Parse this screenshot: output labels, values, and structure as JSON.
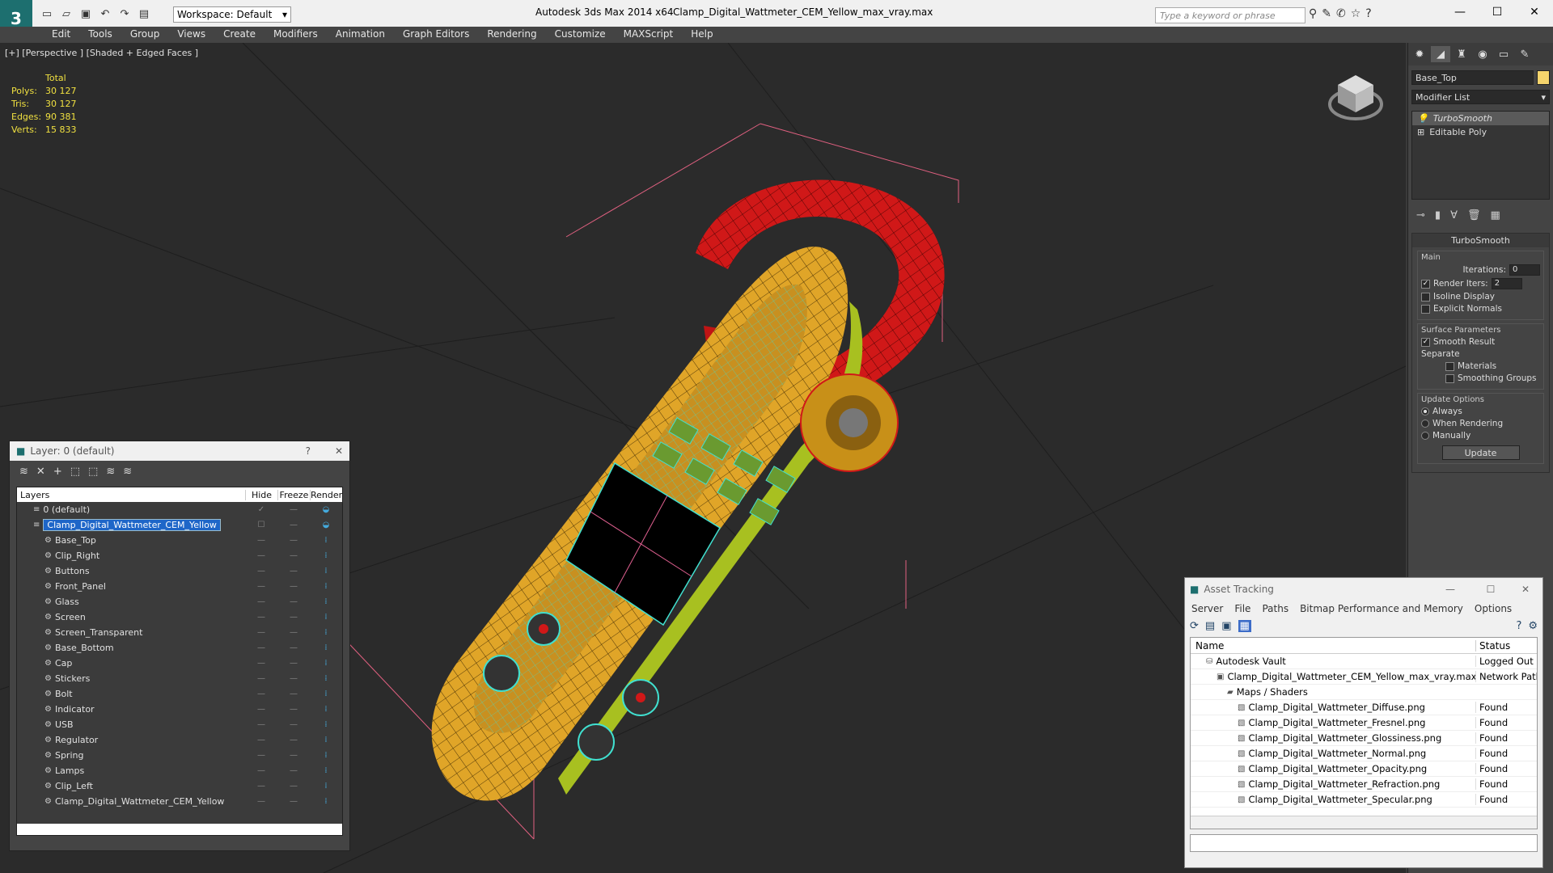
{
  "titlebar": {
    "workspace": "Workspace: Default",
    "app": "Autodesk 3ds Max  2014 x64",
    "file": "Clamp_Digital_Wattmeter_CEM_Yellow_max_vray.max",
    "search_placeholder": "Type a keyword or phrase"
  },
  "menu": [
    "Edit",
    "Tools",
    "Group",
    "Views",
    "Create",
    "Modifiers",
    "Animation",
    "Graph Editors",
    "Rendering",
    "Customize",
    "MAXScript",
    "Help"
  ],
  "viewport": {
    "label": "[+] [Perspective ] [Shaded + Edged Faces ]",
    "stats_header": "Total",
    "stats": [
      {
        "k": "Polys:",
        "v": "30 127"
      },
      {
        "k": "Tris:",
        "v": "30 127"
      },
      {
        "k": "Edges:",
        "v": "90 381"
      },
      {
        "k": "Verts:",
        "v": "15 833"
      }
    ]
  },
  "command_panel": {
    "object_name": "Base_Top",
    "modifier_list": "Modifier List",
    "stack": [
      "TurboSmooth",
      "Editable Poly"
    ],
    "rollout_title": "TurboSmooth",
    "main_group": "Main",
    "iterations_label": "Iterations:",
    "iterations_value": "0",
    "render_iters_label": "Render Iters:",
    "render_iters_value": "2",
    "isoline": "Isoline Display",
    "explicit": "Explicit Normals",
    "surface_group": "Surface Parameters",
    "smooth_result": "Smooth Result",
    "separate": "Separate",
    "materials": "Materials",
    "smoothing_groups": "Smoothing Groups",
    "update_group": "Update Options",
    "always": "Always",
    "when_rendering": "When Rendering",
    "manually": "Manually",
    "update_btn": "Update"
  },
  "layer_window": {
    "title": "Layer: 0 (default)",
    "help": "?",
    "col_layers": "Layers",
    "col_hide": "Hide",
    "col_freeze": "Freeze",
    "col_render": "Render",
    "rows": [
      {
        "name": "0 (default)",
        "indent": 1
      },
      {
        "name": "Clamp_Digital_Wattmeter_CEM_Yellow",
        "indent": 1
      },
      {
        "name": "Base_Top",
        "indent": 2
      },
      {
        "name": "Clip_Right",
        "indent": 2
      },
      {
        "name": "Buttons",
        "indent": 2
      },
      {
        "name": "Front_Panel",
        "indent": 2
      },
      {
        "name": "Glass",
        "indent": 2
      },
      {
        "name": "Screen",
        "indent": 2
      },
      {
        "name": "Screen_Transparent",
        "indent": 2
      },
      {
        "name": "Base_Bottom",
        "indent": 2
      },
      {
        "name": "Cap",
        "indent": 2
      },
      {
        "name": "Stickers",
        "indent": 2
      },
      {
        "name": "Bolt",
        "indent": 2
      },
      {
        "name": "Indicator",
        "indent": 2
      },
      {
        "name": "USB",
        "indent": 2
      },
      {
        "name": "Regulator",
        "indent": 2
      },
      {
        "name": "Spring",
        "indent": 2
      },
      {
        "name": "Lamps",
        "indent": 2
      },
      {
        "name": "Clip_Left",
        "indent": 2
      },
      {
        "name": "Clamp_Digital_Wattmeter_CEM_Yellow",
        "indent": 2
      }
    ]
  },
  "asset_window": {
    "title": "Asset Tracking",
    "menu": [
      "Server",
      "File",
      "Paths",
      "Bitmap Performance and Memory",
      "Options"
    ],
    "col_name": "Name",
    "col_status": "Status",
    "rows": [
      {
        "name": "Autodesk Vault",
        "status": "Logged Out ...",
        "indent": 1
      },
      {
        "name": "Clamp_Digital_Wattmeter_CEM_Yellow_max_vray.max",
        "status": "Network Path",
        "indent": 2
      },
      {
        "name": "Maps / Shaders",
        "status": "",
        "indent": 3
      },
      {
        "name": "Clamp_Digital_Wattmeter_Diffuse.png",
        "status": "Found",
        "indent": 4
      },
      {
        "name": "Clamp_Digital_Wattmeter_Fresnel.png",
        "status": "Found",
        "indent": 4
      },
      {
        "name": "Clamp_Digital_Wattmeter_Glossiness.png",
        "status": "Found",
        "indent": 4
      },
      {
        "name": "Clamp_Digital_Wattmeter_Normal.png",
        "status": "Found",
        "indent": 4
      },
      {
        "name": "Clamp_Digital_Wattmeter_Opacity.png",
        "status": "Found",
        "indent": 4
      },
      {
        "name": "Clamp_Digital_Wattmeter_Refraction.png",
        "status": "Found",
        "indent": 4
      },
      {
        "name": "Clamp_Digital_Wattmeter_Specular.png",
        "status": "Found",
        "indent": 4
      }
    ]
  },
  "colors": {
    "selection": "#1e66c8",
    "stats": "#f0e040",
    "model_body": "#e0a528",
    "model_clamp": "#d01818",
    "wire": "#40e0d0"
  }
}
